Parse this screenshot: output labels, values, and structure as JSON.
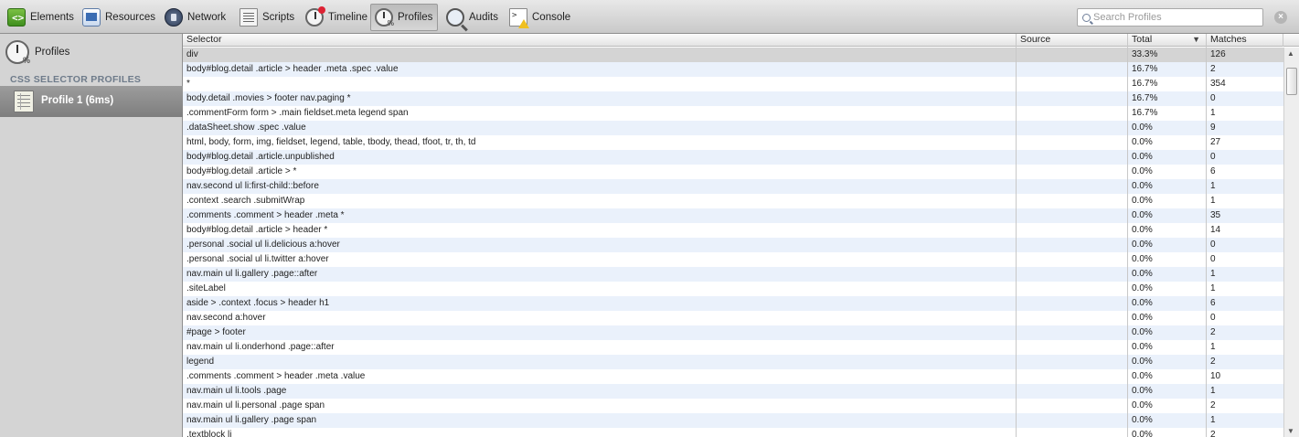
{
  "toolbar": {
    "items": [
      {
        "label": "Elements",
        "icon": "elements-icon",
        "active": false
      },
      {
        "label": "Resources",
        "icon": "resources-icon",
        "active": false
      },
      {
        "label": "Network",
        "icon": "network-icon",
        "active": false
      },
      {
        "label": "Scripts",
        "icon": "scripts-icon",
        "active": false
      },
      {
        "label": "Timeline",
        "icon": "timeline-icon",
        "active": false
      },
      {
        "label": "Profiles",
        "icon": "profiles-icon",
        "active": true
      },
      {
        "label": "Audits",
        "icon": "audits-icon",
        "active": false
      },
      {
        "label": "Console",
        "icon": "console-icon",
        "active": false
      }
    ],
    "search_placeholder": "Search Profiles",
    "close_icon": "close-icon"
  },
  "sidebar": {
    "title": "Profiles",
    "heading": "CSS SELECTOR PROFILES",
    "profile": {
      "label": "Profile 1 (6ms)",
      "icon": "profile-icon"
    }
  },
  "grid": {
    "columns": {
      "selector": "Selector",
      "source": "Source",
      "total": "Total",
      "matches": "Matches"
    },
    "sort_indicator": "▼",
    "rows": [
      {
        "selector": "div",
        "source": "",
        "total": "33.3%",
        "matches": "126"
      },
      {
        "selector": "body#blog.detail .article > header .meta .spec .value",
        "source": "",
        "total": "16.7%",
        "matches": "2"
      },
      {
        "selector": "*",
        "source": "",
        "total": "16.7%",
        "matches": "354"
      },
      {
        "selector": "body.detail .movies > footer nav.paging *",
        "source": "",
        "total": "16.7%",
        "matches": "0"
      },
      {
        "selector": ".commentForm form > .main fieldset.meta legend span",
        "source": "",
        "total": "16.7%",
        "matches": "1"
      },
      {
        "selector": ".dataSheet.show .spec .value",
        "source": "",
        "total": "0.0%",
        "matches": "9"
      },
      {
        "selector": "html, body, form, img, fieldset, legend, table, tbody, thead, tfoot, tr, th, td",
        "source": "",
        "total": "0.0%",
        "matches": "27"
      },
      {
        "selector": "body#blog.detail .article.unpublished",
        "source": "",
        "total": "0.0%",
        "matches": "0"
      },
      {
        "selector": "body#blog.detail .article > *",
        "source": "",
        "total": "0.0%",
        "matches": "6"
      },
      {
        "selector": "nav.second ul li:first-child::before",
        "source": "",
        "total": "0.0%",
        "matches": "1"
      },
      {
        "selector": ".context .search .submitWrap",
        "source": "",
        "total": "0.0%",
        "matches": "1"
      },
      {
        "selector": ".comments .comment > header .meta *",
        "source": "",
        "total": "0.0%",
        "matches": "35"
      },
      {
        "selector": "body#blog.detail .article > header *",
        "source": "",
        "total": "0.0%",
        "matches": "14"
      },
      {
        "selector": ".personal .social ul li.delicious a:hover",
        "source": "",
        "total": "0.0%",
        "matches": "0"
      },
      {
        "selector": ".personal .social ul li.twitter a:hover",
        "source": "",
        "total": "0.0%",
        "matches": "0"
      },
      {
        "selector": "nav.main ul li.gallery .page::after",
        "source": "",
        "total": "0.0%",
        "matches": "1"
      },
      {
        "selector": ".siteLabel",
        "source": "",
        "total": "0.0%",
        "matches": "1"
      },
      {
        "selector": "aside > .context .focus > header h1",
        "source": "",
        "total": "0.0%",
        "matches": "6"
      },
      {
        "selector": "nav.second a:hover",
        "source": "",
        "total": "0.0%",
        "matches": "0"
      },
      {
        "selector": "#page > footer",
        "source": "",
        "total": "0.0%",
        "matches": "2"
      },
      {
        "selector": "nav.main ul li.onderhond .page::after",
        "source": "",
        "total": "0.0%",
        "matches": "1"
      },
      {
        "selector": "legend",
        "source": "",
        "total": "0.0%",
        "matches": "2"
      },
      {
        "selector": ".comments .comment > header .meta .value",
        "source": "",
        "total": "0.0%",
        "matches": "10"
      },
      {
        "selector": "nav.main ul li.tools .page",
        "source": "",
        "total": "0.0%",
        "matches": "1"
      },
      {
        "selector": "nav.main ul li.personal .page span",
        "source": "",
        "total": "0.0%",
        "matches": "2"
      },
      {
        "selector": "nav.main ul li.gallery .page span",
        "source": "",
        "total": "0.0%",
        "matches": "1"
      },
      {
        "selector": ".textblock li",
        "source": "",
        "total": "0.0%",
        "matches": "2"
      }
    ]
  },
  "colors": {
    "row_alt": "#eaf1fb",
    "selected": "#d4d4d4",
    "sidebar": "#d4d4d4",
    "heading": "#6e7b8a"
  }
}
